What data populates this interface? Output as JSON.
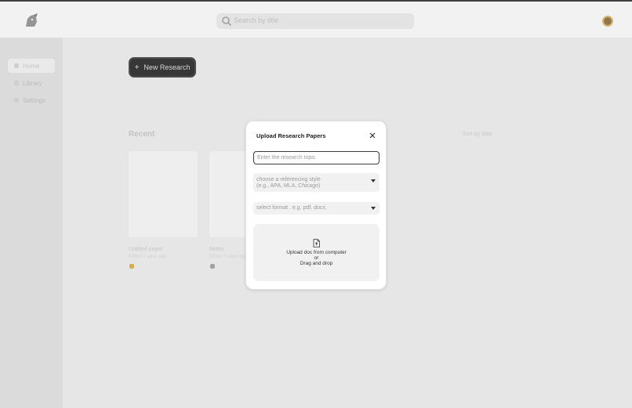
{
  "topbar": {
    "logo_icon": "mascot-logo-icon",
    "search": {
      "placeholder": "Search by title",
      "icon": "search-icon"
    },
    "avatar_icon": "user-avatar"
  },
  "sidebar": {
    "items": [
      {
        "label": "Home",
        "icon": "home-icon",
        "active": true
      },
      {
        "label": "Library",
        "icon": "library-icon",
        "active": false
      },
      {
        "label": "Settings",
        "icon": "settings-icon",
        "active": false
      }
    ]
  },
  "main": {
    "new_button": {
      "label": "New Research",
      "icon": "plus-icon"
    },
    "section_title": "Recent",
    "sort_label": "Sort by date",
    "cards": [
      {
        "title": "Untitled paper",
        "subtitle": "Edited 2 days ago",
        "tag_color": "#d9a441"
      },
      {
        "title": "Notes",
        "subtitle": "Edited 3 days ago",
        "tag_color": "#9a9a9a"
      }
    ]
  },
  "modal": {
    "title": "Upload Research Papers",
    "close_icon": "close-icon",
    "topic_input": {
      "placeholder": "Enter the research topic",
      "value": ""
    },
    "referencing_style": {
      "placeholder_line1": "choose a referencing style",
      "placeholder_line2": "(e.g., APA, MLA, Chicago)",
      "icon": "caret-down-icon"
    },
    "format": {
      "placeholder": "select format . e.g. pdf, docx.",
      "icon": "caret-down-icon"
    },
    "upload": {
      "icon": "file-upload-icon",
      "line1": "Upload doc from computer",
      "line2": "or",
      "line3": "Drag and drop"
    }
  },
  "colors": {
    "accent_dark": "#222222",
    "modal_bg": "#ffffff",
    "field_bg": "#f1f1f1",
    "backdrop": "#e9e9e9"
  }
}
